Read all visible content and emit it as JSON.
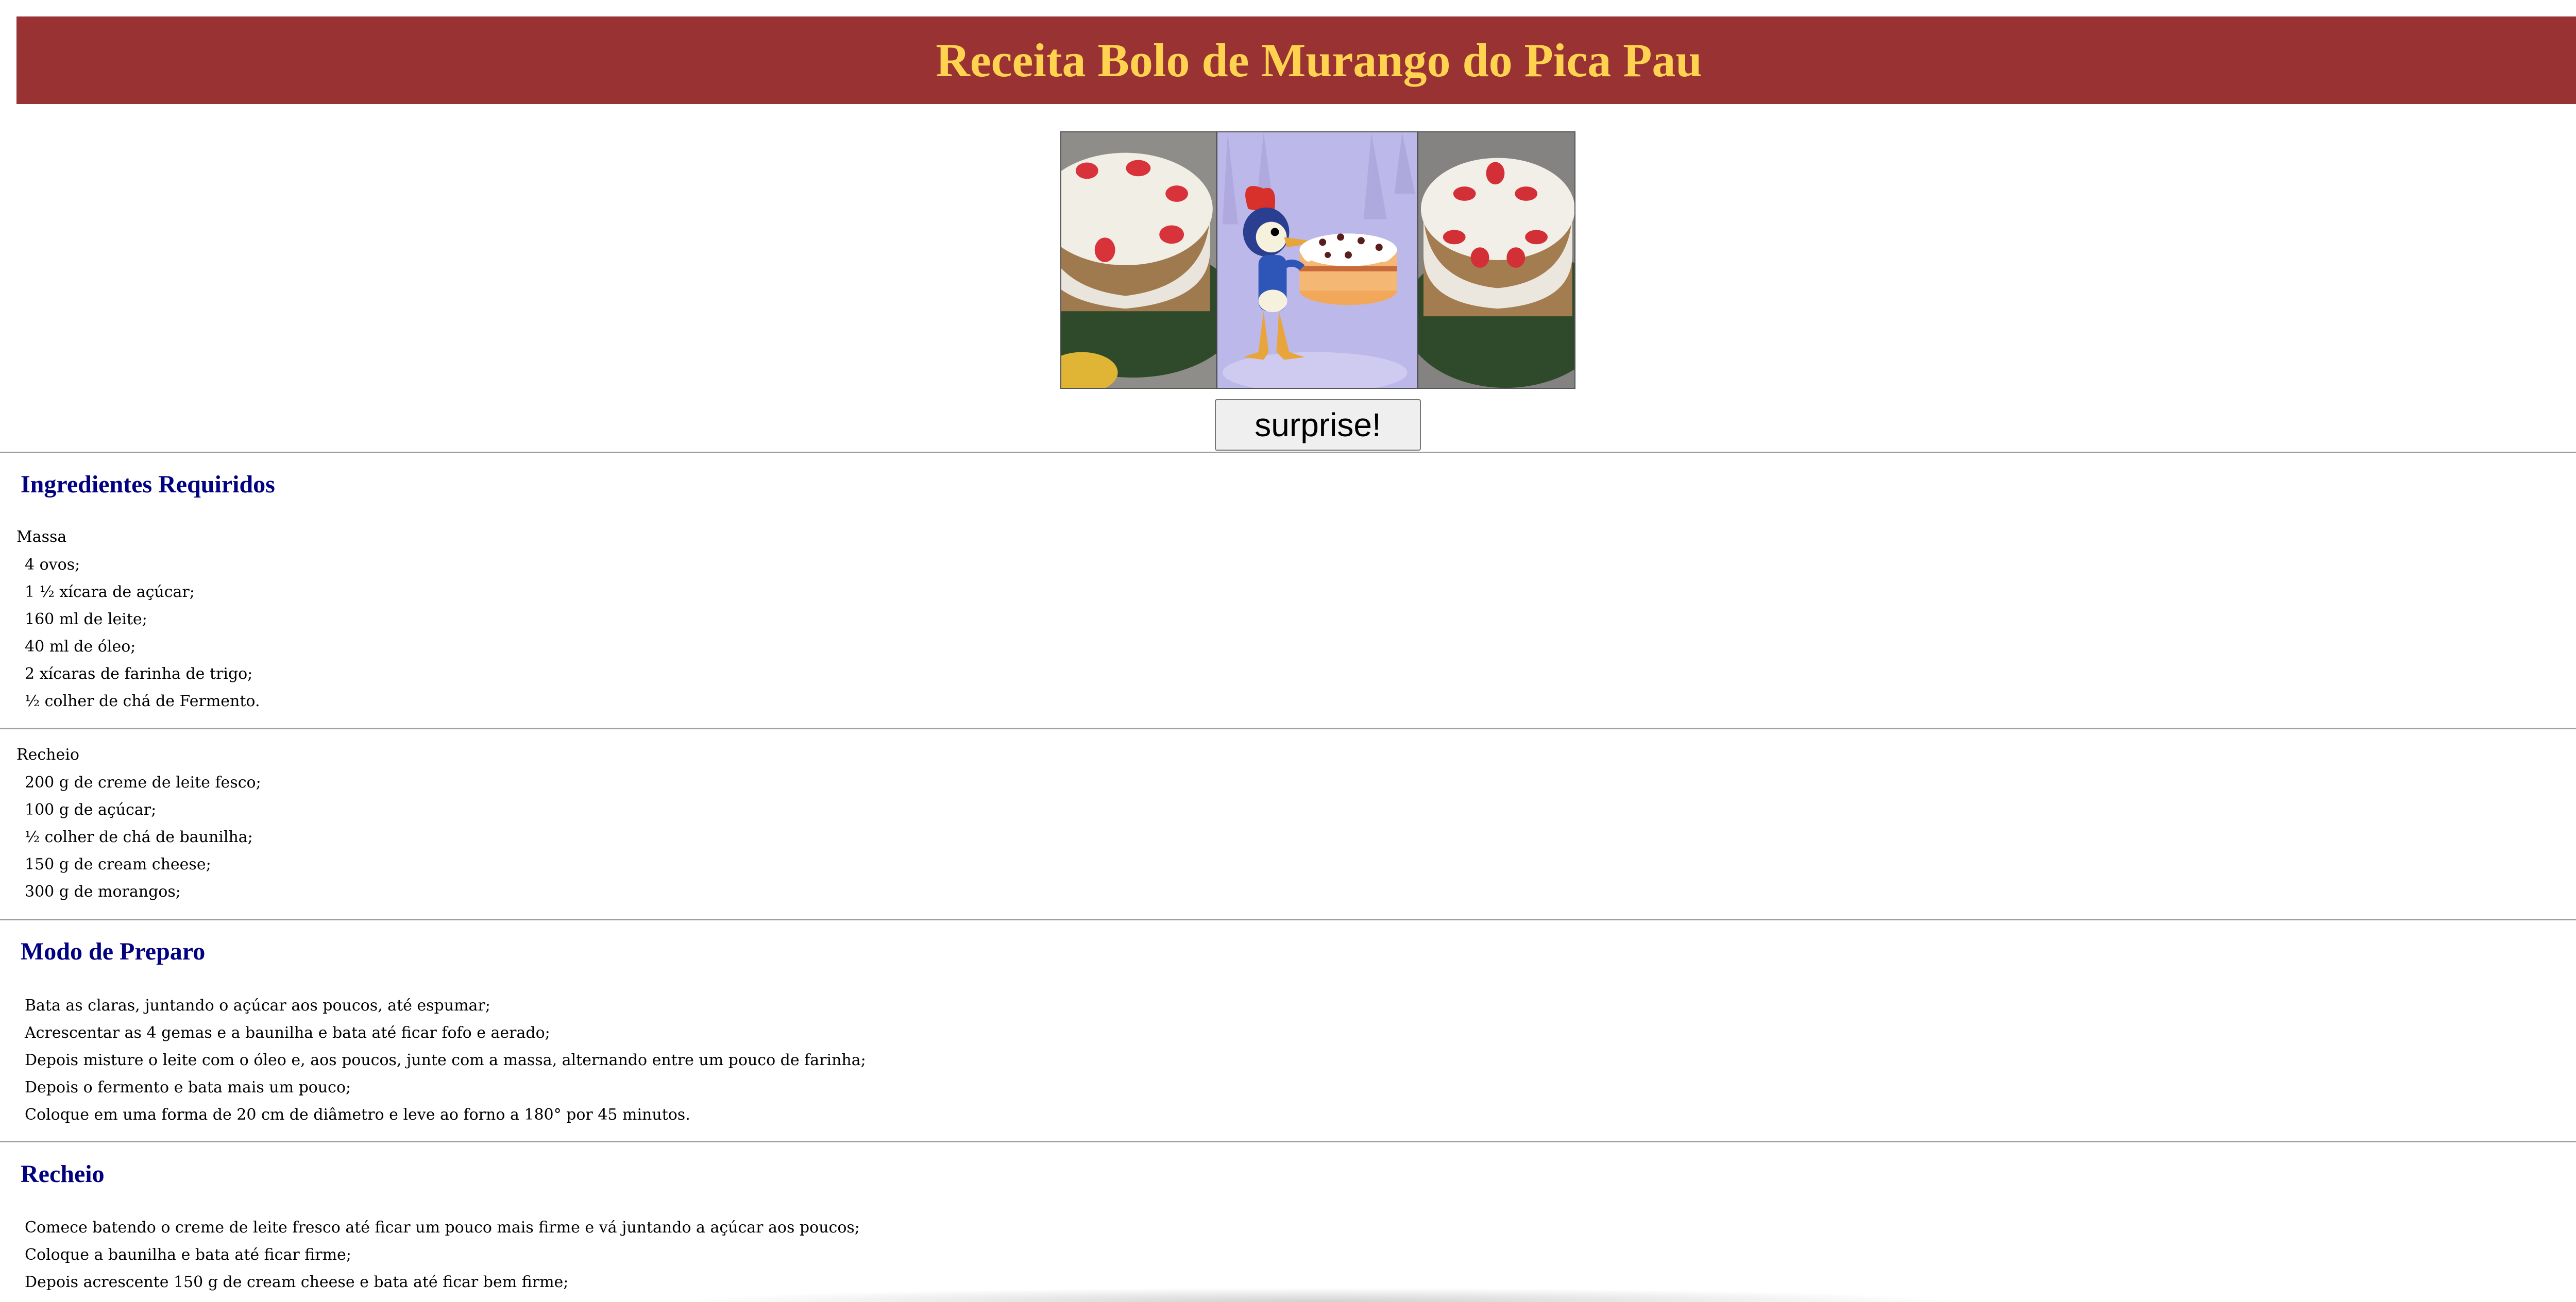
{
  "header": {
    "title": "Receita Bolo de Murango do Pica Pau"
  },
  "gallery": {
    "images": [
      {
        "name": "strawberry-cake-photo-left"
      },
      {
        "name": "woody-woodpecker-cake-cartoon"
      },
      {
        "name": "strawberry-cake-photo-right"
      }
    ]
  },
  "surprise_button": {
    "label": "surprise!"
  },
  "ingredients": {
    "title": "Ingredientes Requiridos",
    "massa": {
      "label": "Massa",
      "items": [
        "4 ovos;",
        "1 ½ xícara de açúcar;",
        "160 ml de leite;",
        "40 ml de óleo;",
        "2 xícaras de farinha de trigo;",
        "½ colher de chá de Fermento."
      ]
    },
    "recheio": {
      "label": "Recheio",
      "items": [
        "200 g de creme de leite fesco;",
        "100 g de açúcar;",
        "½ colher de chá de baunilha;",
        "150 g de cream cheese;",
        "300 g de morangos;"
      ]
    }
  },
  "preparo": {
    "title": "Modo de Preparo",
    "items": [
      "Bata as claras, juntando o açúcar aos poucos, até espumar;",
      "Acrescentar as 4 gemas e a baunilha e bata até ficar fofo e aerado;",
      "Depois misture o leite com o óleo e, aos poucos, junte com a massa, alternando entre um pouco de farinha;",
      "Depois o fermento e bata mais um pouco;",
      "Coloque em uma forma de 20 cm de diâmetro e leve ao forno a 180° por 45 minutos."
    ]
  },
  "recheio_section": {
    "title": "Recheio",
    "items": [
      "Comece batendo o creme de leite fresco até ficar um pouco mais firme e vá juntando a açúcar aos poucos;",
      "Coloque a baunilha e bata até ficar firme;",
      "Depois acrescente 150 g de cream cheese e bata até ficar bem firme;"
    ]
  },
  "colors": {
    "header_bg": "#993333",
    "title": "#ffd34f",
    "section_heading": "#000080"
  }
}
